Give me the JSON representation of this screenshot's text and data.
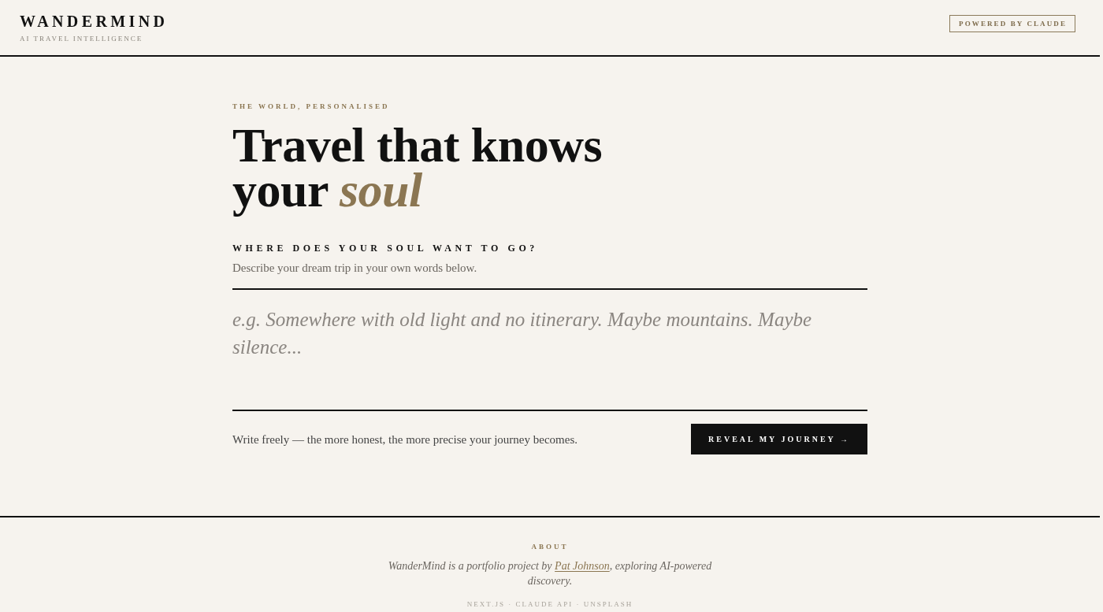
{
  "header": {
    "logo": "WANDERMIND",
    "tagline": "AI TRAVEL INTELLIGENCE",
    "badge": "POWERED BY CLAUDE"
  },
  "hero": {
    "eyebrow": "THE WORLD, PERSONALISED",
    "heading": "Travel that knows your *soul*"
  },
  "prompt": {
    "label": "WHERE DOES YOUR SOUL WANT TO GO?",
    "hint": "Describe your dream trip in your own words below.",
    "placeholder": "e.g. Somewhere with old light and no itinerary. Maybe mountains. Maybe silence...",
    "note": "Write freely — the more honest, the more precise your journey becomes.",
    "button": "REVEAL MY JOURNEY →"
  },
  "footer": {
    "heading": "ABOUT",
    "text_before": "WanderMind is a portfolio project by ",
    "link": "Pat Johnson",
    "text_after": ", exploring AI-powered discovery.",
    "credits": "NEXT.JS · CLAUDE API · UNSPLASH"
  }
}
